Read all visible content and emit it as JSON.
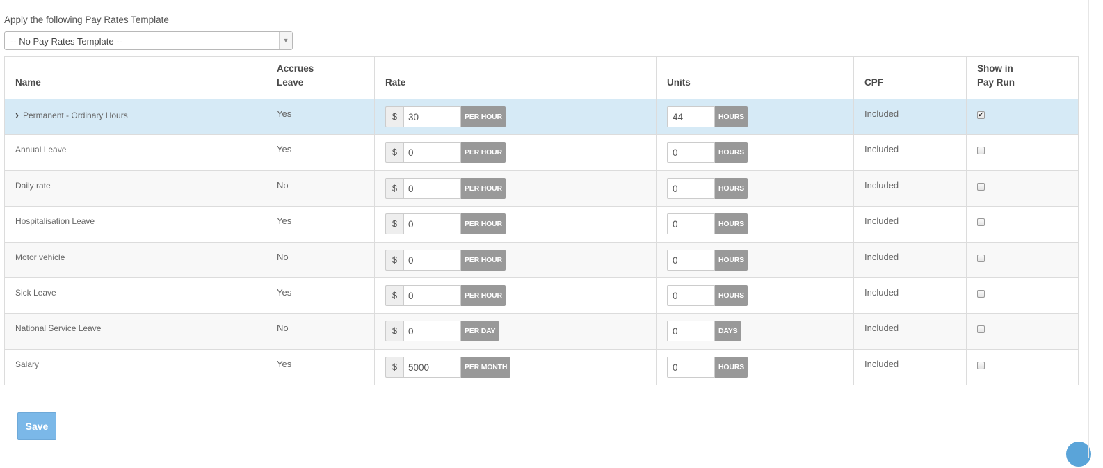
{
  "template": {
    "label": "Apply the following Pay Rates Template",
    "selected": "-- No Pay Rates Template --",
    "arrow": "▼"
  },
  "table": {
    "headers": {
      "name": "Name",
      "accrues_line1": "Accrues",
      "accrues_line2": "Leave",
      "rate": "Rate",
      "units": "Units",
      "cpf": "CPF",
      "show_line1": "Show in",
      "show_line2": "Pay Run"
    },
    "rows": [
      {
        "name": "Permanent - Ordinary Hours",
        "expandable": true,
        "accrues": "Yes",
        "currency": "$",
        "rate": "30",
        "rate_unit": "PER HOUR",
        "units": "44",
        "units_label": "HOURS",
        "cpf": "Included",
        "show": true,
        "selected": true
      },
      {
        "name": "Annual Leave",
        "accrues": "Yes",
        "currency": "$",
        "rate": "0",
        "rate_unit": "PER HOUR",
        "units": "0",
        "units_label": "HOURS",
        "cpf": "Included",
        "show": false
      },
      {
        "name": "Daily rate",
        "accrues": "No",
        "currency": "$",
        "rate": "0",
        "rate_unit": "PER HOUR",
        "units": "0",
        "units_label": "HOURS",
        "cpf": "Included",
        "show": false
      },
      {
        "name": "Hospitalisation Leave",
        "accrues": "Yes",
        "currency": "$",
        "rate": "0",
        "rate_unit": "PER HOUR",
        "units": "0",
        "units_label": "HOURS",
        "cpf": "Included",
        "show": false
      },
      {
        "name": "Motor vehicle",
        "accrues": "No",
        "currency": "$",
        "rate": "0",
        "rate_unit": "PER HOUR",
        "units": "0",
        "units_label": "HOURS",
        "cpf": "Included",
        "show": false
      },
      {
        "name": "Sick Leave",
        "accrues": "Yes",
        "currency": "$",
        "rate": "0",
        "rate_unit": "PER HOUR",
        "units": "0",
        "units_label": "HOURS",
        "cpf": "Included",
        "show": false
      },
      {
        "name": "National Service Leave",
        "accrues": "No",
        "currency": "$",
        "rate": "0",
        "rate_unit": "PER DAY",
        "units": "0",
        "units_label": "DAYS",
        "cpf": "Included",
        "show": false
      },
      {
        "name": "Salary",
        "accrues": "Yes",
        "currency": "$",
        "rate": "5000",
        "rate_unit": "PER MONTH",
        "units": "0",
        "units_label": "HOURS",
        "cpf": "Included",
        "show": false
      }
    ]
  },
  "actions": {
    "save_label": "Save"
  },
  "icons": {
    "expand": "chevron-right-icon",
    "help": "help-icon"
  },
  "colors": {
    "selected_row": "#d6eaf6",
    "save_button": "#7bb8e8",
    "unit_badge": "#999999"
  }
}
